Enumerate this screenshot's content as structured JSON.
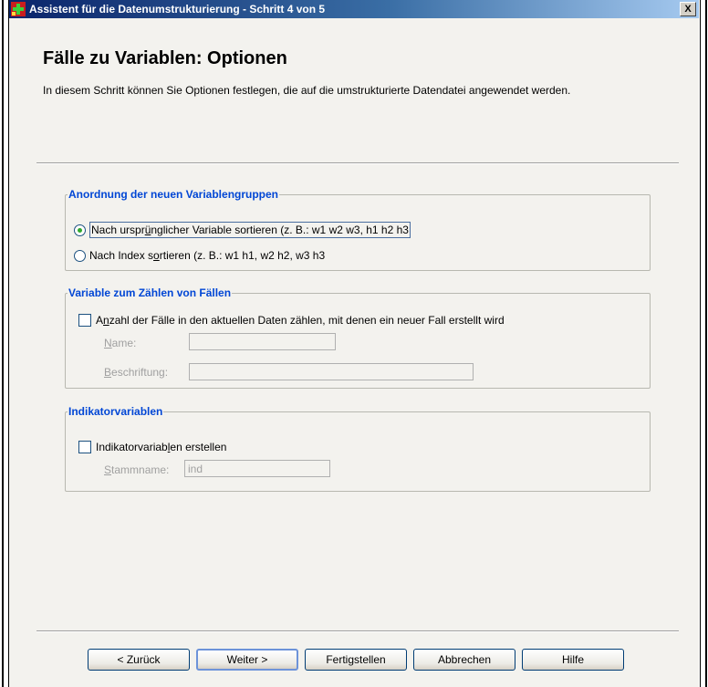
{
  "window": {
    "title": "Assistent für die Datenumstrukturierung - Schritt 4 von 5",
    "close_label": "X"
  },
  "page": {
    "title": "Fälle zu Variablen: Optionen",
    "description": "In diesem Schritt können Sie Optionen festlegen, die auf die umstrukturierte Datendatei angewendet werden."
  },
  "group_order": {
    "legend": "Anordnung der neuen Variablengruppen",
    "options": [
      {
        "pre": "Nach urspr",
        "key": "ü",
        "post": "nglicher Variable sortieren (z. B.: w1 w2 w3, h1 h2 h3",
        "selected": true
      },
      {
        "pre": "Nach Index s",
        "key": "o",
        "post": "rtieren (z. B.: w1 h1, w2 h2, w3 h3",
        "selected": false
      }
    ]
  },
  "group_count": {
    "legend": "Variable zum Zählen von Fällen",
    "checkbox": {
      "pre": "A",
      "key": "n",
      "post": "zahl der Fälle in den aktuellen Daten zählen, mit denen ein neuer Fall erstellt wird",
      "checked": false
    },
    "name_label": {
      "pre": "",
      "key": "N",
      "post": "ame:"
    },
    "name_value": "",
    "label_label": {
      "pre": "",
      "key": "B",
      "post": "eschriftung:"
    },
    "label_value": ""
  },
  "group_indicator": {
    "legend": "Indikatorvariablen",
    "checkbox": {
      "pre": "Indikatorvariab",
      "key": "l",
      "post": "en erstellen",
      "checked": false
    },
    "stem_label": {
      "pre": "",
      "key": "S",
      "post": "tammname:"
    },
    "stem_value": "ind"
  },
  "buttons": {
    "back": "< Zurück",
    "next": "Weiter >",
    "finish": "Fertigstellen",
    "cancel": "Abbrechen",
    "help": "Hilfe"
  },
  "colors": {
    "accent_legend": "#0046d5",
    "titlebar": "#0a246a",
    "radio_selected": "#2fa82f"
  }
}
